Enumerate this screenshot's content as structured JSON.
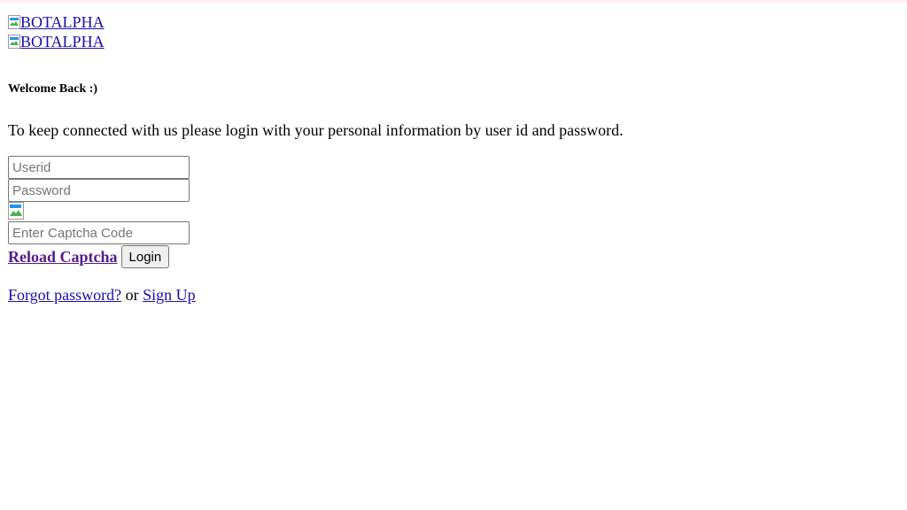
{
  "logos": [
    {
      "alt": "BOTALPHA"
    },
    {
      "alt": "BOTALPHA"
    }
  ],
  "welcome": "Welcome Back :)",
  "intro": "To keep connected with us please login with your personal information by user id and password.",
  "form": {
    "userid_placeholder": "Userid",
    "password_placeholder": "Password",
    "captcha_placeholder": "Enter Captcha Code",
    "reload_captcha_label": "Reload Captcha",
    "login_label": "Login"
  },
  "footer": {
    "forgot_label": "Forgot password?",
    "separator": "or",
    "signup_label": "Sign Up"
  },
  "colors": {
    "link": "#1a0dab",
    "visited_link": "#551a8b",
    "top_border": "#fdeef0"
  }
}
